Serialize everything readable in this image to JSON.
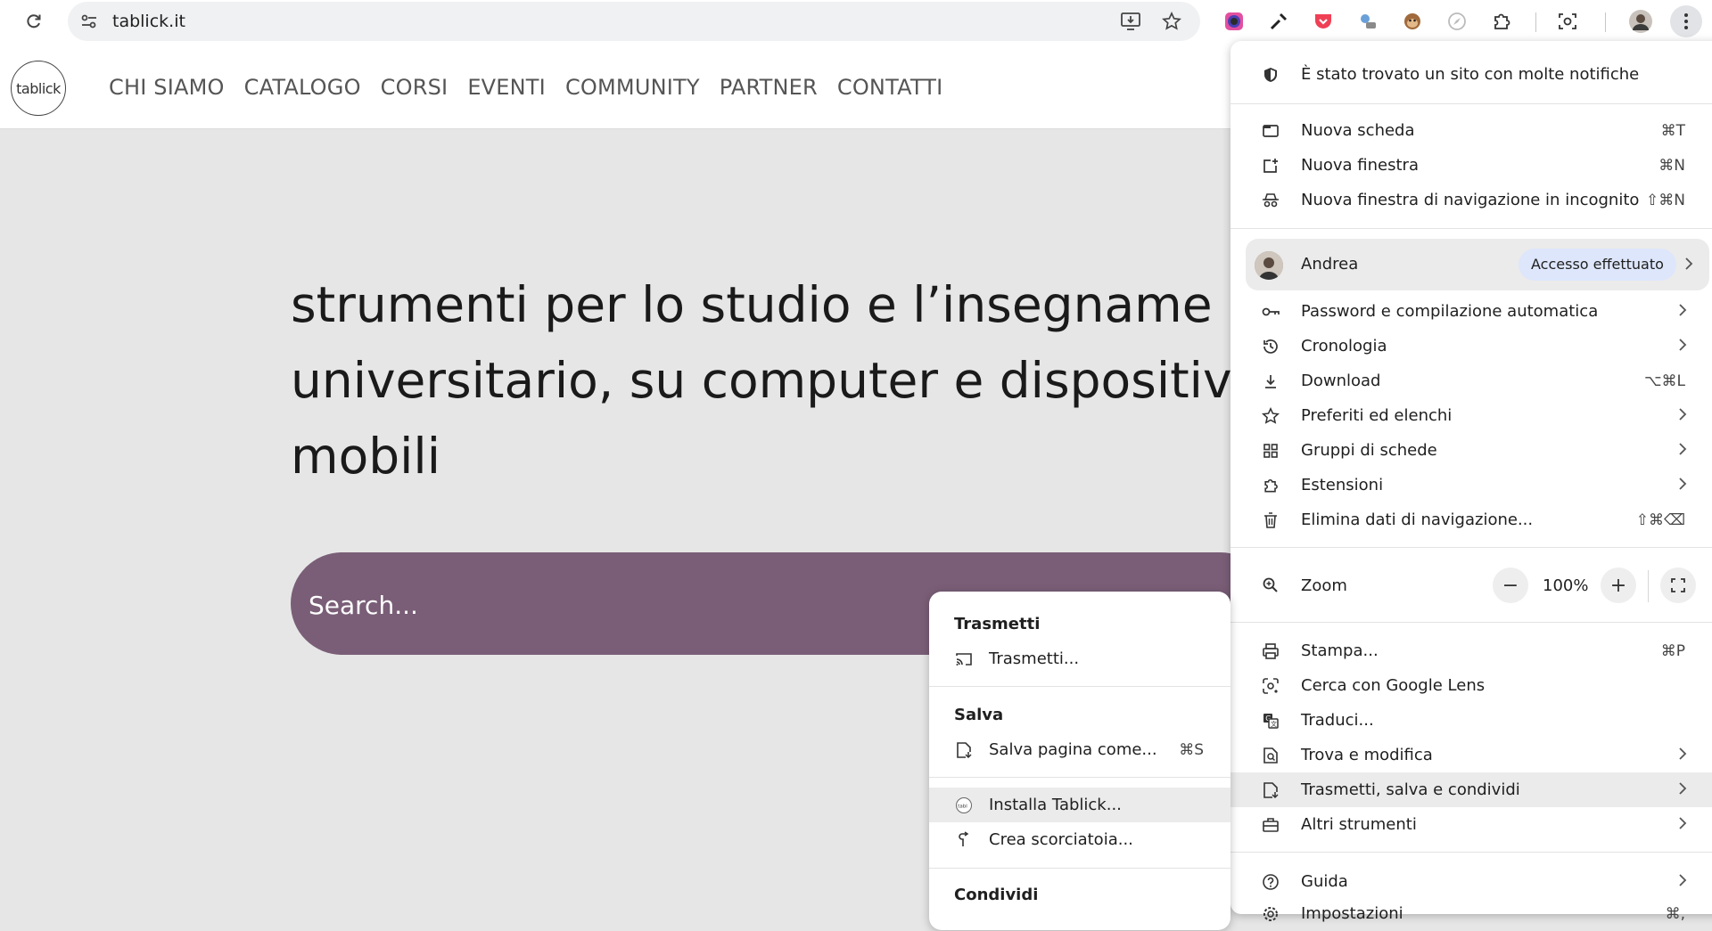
{
  "browser": {
    "url": "tablick.it"
  },
  "site": {
    "logo_text": "tablick",
    "nav": [
      "CHI SIAMO",
      "CATALOGO",
      "CORSI",
      "EVENTI",
      "COMMUNITY",
      "PARTNER",
      "CONTATTI"
    ],
    "hero_lines": [
      "strumenti per lo studio e l’insegname",
      "universitario, su computer e dispositiv",
      "mobili"
    ],
    "search_placeholder": "Search...",
    "search_color": "#7a5e77"
  },
  "menu": {
    "notice": "È stato trovato un sito con molte notifiche",
    "items_top": [
      {
        "label": "Nuova scheda",
        "shortcut": "⌘T",
        "icon": "new-tab-icon"
      },
      {
        "label": "Nuova finestra",
        "shortcut": "⌘N",
        "icon": "new-window-icon"
      },
      {
        "label": "Nuova finestra di navigazione in incognito",
        "shortcut": "⇧⌘N",
        "icon": "incognito-icon"
      }
    ],
    "profile": {
      "name": "Andrea",
      "badge": "Accesso effettuato"
    },
    "items_mid": [
      {
        "label": "Password e compilazione automatica",
        "shortcut": "",
        "submenu": true,
        "icon": "key-icon"
      },
      {
        "label": "Cronologia",
        "shortcut": "",
        "submenu": true,
        "icon": "history-icon"
      },
      {
        "label": "Download",
        "shortcut": "⌥⌘L",
        "submenu": false,
        "icon": "download-icon"
      },
      {
        "label": "Preferiti ed elenchi",
        "shortcut": "",
        "submenu": true,
        "icon": "star-icon"
      },
      {
        "label": "Gruppi di schede",
        "shortcut": "",
        "submenu": true,
        "icon": "grid-icon"
      },
      {
        "label": "Estensioni",
        "shortcut": "",
        "submenu": true,
        "icon": "puzzle-icon"
      },
      {
        "label": "Elimina dati di navigazione...",
        "shortcut": "⇧⌘⌫",
        "submenu": false,
        "icon": "trash-icon"
      }
    ],
    "zoom": {
      "label": "Zoom",
      "value": "100%",
      "minus": "−",
      "plus": "+"
    },
    "items_bottom": [
      {
        "label": "Stampa...",
        "shortcut": "⌘P",
        "submenu": false,
        "icon": "print-icon"
      },
      {
        "label": "Cerca con Google Lens",
        "shortcut": "",
        "submenu": false,
        "icon": "lens-icon"
      },
      {
        "label": "Traduci...",
        "shortcut": "",
        "submenu": false,
        "icon": "translate-icon"
      },
      {
        "label": "Trova e modifica",
        "shortcut": "",
        "submenu": true,
        "icon": "find-icon"
      },
      {
        "label": "Trasmetti, salva e condividi",
        "shortcut": "",
        "submenu": true,
        "icon": "save-share-icon"
      },
      {
        "label": "Altri strumenti",
        "shortcut": "",
        "submenu": true,
        "icon": "toolbox-icon"
      }
    ],
    "items_end": [
      {
        "label": "Guida",
        "shortcut": "",
        "submenu": true,
        "icon": "help-icon"
      },
      {
        "label": "Impostazioni",
        "shortcut": "⌘,",
        "submenu": false,
        "icon": "settings-icon"
      }
    ]
  },
  "submenu": {
    "cast_header": "Trasmetti",
    "cast_item": "Trasmetti...",
    "save_header": "Salva",
    "save_item": "Salva pagina come...",
    "save_shortcut": "⌘S",
    "install_item": "Installa Tablick...",
    "shortcut_item": "Crea scorciatoia...",
    "share_header": "Condividi"
  }
}
